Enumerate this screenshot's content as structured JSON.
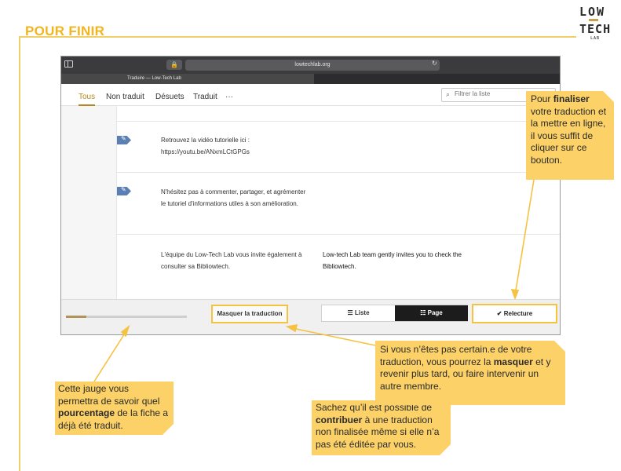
{
  "slide": {
    "title": "POUR FINIR"
  },
  "logo": {
    "line1": "LOW",
    "line2": "TECH",
    "line3": "LAB"
  },
  "browser": {
    "url": "lowtechlab.org",
    "lock_icon": "🔒",
    "reload_icon": "↻",
    "tab_title": "Traduire — Low-Tech Lab"
  },
  "nav": {
    "tabs": [
      {
        "label": "Tous",
        "active": true
      },
      {
        "label": "Non traduit"
      },
      {
        "label": "Désuets"
      },
      {
        "label": "Traduit"
      },
      {
        "label": "···"
      }
    ],
    "filter_placeholder": "Filtrer la liste",
    "search_icon": "⌕"
  },
  "segments": [
    {
      "source": "Retrouvez la vidéo tutorielle ici : https://youtu.be/ANxmLCtGPGs",
      "target": ""
    },
    {
      "source": "N'hésitez pas à commenter, partager, et agrémenter le tutoriel d'informations utiles à son amélioration.",
      "target": ""
    },
    {
      "source": "L'équipe du Low-Tech Lab vous invite également à consulter sa Bibliowtech.",
      "target": "Low-tech Lab team gently invites you to check the Bibliowtech."
    }
  ],
  "bottom": {
    "progress": 0.17,
    "mask_label": "Masquer la traduction",
    "liste_label": "☰ Liste",
    "page_label": "☷ Page",
    "relecture_label": "✔ Relecture"
  },
  "callouts": {
    "finaliser": {
      "pre": "Pour ",
      "bold": "finaliser",
      "post": " votre traduction et la mettre en ligne, il vous suffit de cliquer sur ce bouton."
    },
    "gauge": {
      "pre": "Cette jauge vous permettra de savoir quel ",
      "bold": "pourcentage",
      "post": " de la fiche a déjà été traduit."
    },
    "contribuer": {
      "pre": "Sachez qu’il est possible de ",
      "bold": "contribuer",
      "post": " à une traduction non finalisée même si elle n’a pas été éditée par vous."
    },
    "masquer": {
      "pre": "Si vous n’êtes pas certain.e de votre traduction, vous pourrez la ",
      "bold": "masquer",
      "post": " et y revenir plus tard, ou faire intervenir un autre membre."
    }
  },
  "colors": {
    "accent": "#f2b51d",
    "callout": "#fcd167",
    "tag": "#5b7fb3"
  }
}
